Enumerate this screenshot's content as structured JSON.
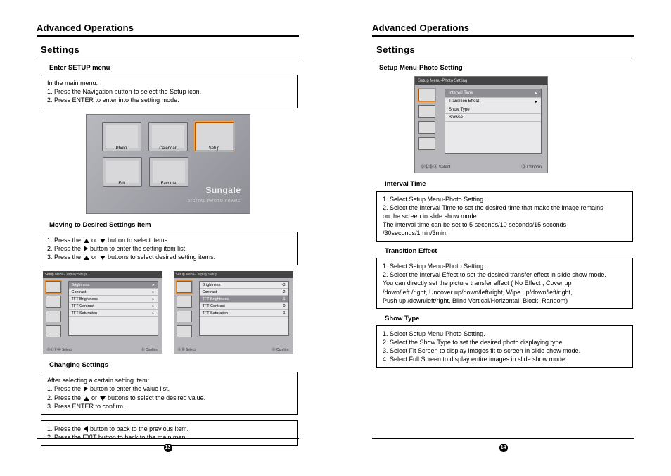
{
  "left": {
    "header": "Advanced Operations",
    "section": "Settings",
    "sub1": "Enter SETUP menu",
    "box1": {
      "l1": "In the main menu:",
      "l2": "1. Press the Navigation button to select the Setup icon.",
      "l3": "2. Press ENTER to enter into the setting mode."
    },
    "mainShot": {
      "tiles": [
        "Photo",
        "Calendar",
        "Setup",
        "Edit",
        "Favorite",
        ""
      ],
      "brand": "Sungale",
      "brandSub": "DIGITAL PHOTO FRAME"
    },
    "sub2": "Moving  to Desired Settings item",
    "box2": {
      "p1a": "1. Press the ",
      "p1b": " or ",
      "p1c": " button to select items.",
      "p2a": "2. Press the ",
      "p2b": " button to enter the setting item list.",
      "p3a": "3. Press the ",
      "p3b": " or ",
      "p3c": " buttons to select desired setting items."
    },
    "miniA": {
      "title": "Setup Menu-Display Setup",
      "items": [
        "Brightness",
        "Contrast",
        "TFT Brightness",
        "TFT Contrast",
        "TFT Saturation"
      ],
      "footL": "ⓄⓁⒹⒶ  Select",
      "footR": "Ⓞ  Confirm"
    },
    "miniB": {
      "title": "Setup Menu-Display Setup",
      "items": [
        {
          "k": "Brightness",
          "v": "-3"
        },
        {
          "k": "Contrast",
          "v": "-2"
        },
        {
          "k": "TFT Brightness",
          "v": "-1"
        },
        {
          "k": "TFT Contrast",
          "v": "0"
        },
        {
          "k": "TFT Saturation",
          "v": "1"
        }
      ],
      "footL": "ⓄⒹ  Select",
      "footR": "Ⓞ  Confirm"
    },
    "sub3": "Changing Settings",
    "box3": {
      "l1": "After selecting a certain setting item:",
      "p1a": "1. Press the ",
      "p1b": " button to enter the value list.",
      "p2a": "2. Press the ",
      "p2b": " or ",
      "p2c": " buttons to select the desired value.",
      "l4": "3. Press ENTER to confirm."
    },
    "box4": {
      "p1a": "1. Press the ",
      "p1b": " button to back to the previous item.",
      "l2": "2. Press the EXIT button to back to the main menu."
    },
    "page": "13"
  },
  "right": {
    "header": "Advanced Operations",
    "section": "Settings",
    "sub1": "Setup Menu-Photo Setting",
    "shot": {
      "title": "Setup Menu-Photo Setting",
      "items": [
        "Interval Time",
        "Transition Effect",
        "Show Type",
        "Browse"
      ],
      "footL": "ⓄⓁⒹⒶ  Select",
      "footR": "Ⓞ  Confirm"
    },
    "sub2": "Interval Time",
    "box2": {
      "l1": "1. Select Setup Menu-Photo Setting.",
      "l2": "2. Select the Interval Time to set the desired time that make the image remains",
      "l2b": "    on the screen in slide show mode.",
      "l3": "The interval time  can be set to 5 seconds/10 seconds/15 seconds",
      "l4": "/30seconds/1min/3min."
    },
    "sub3": "Transition Effect",
    "box3": {
      "l1": "1. Select Setup Menu-Photo Setting.",
      "l2": "2. Select the Interval Effect to set the desired transfer effect in slide show mode.",
      "l3": "You can directly set  the picture  transfer effect ( No Effect , Cover up",
      "l4": "/down/left /right,  Uncover up/down/left/right, Wipe up/down/left/right,",
      "l5": "Push up /down/left/right,  Blind Vertical/Horizontal,  Block, Random)"
    },
    "sub4": "Show Type",
    "box4": {
      "l1": "1. Select Setup Menu-Photo Setting.",
      "l2": "2. Select the Show Type to set the desired photo displaying type.",
      "l3": "3. Select Fit Screen to display images fit to screen in slide show mode.",
      "l4": "4. Select Full Screen to display entire images in slide show mode."
    },
    "page": "14"
  }
}
